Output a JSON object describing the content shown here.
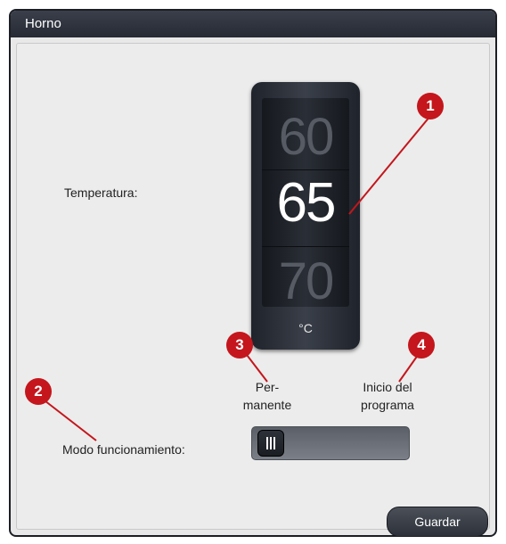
{
  "window": {
    "title": "Horno"
  },
  "temperature": {
    "label": "Temperatura:",
    "prev": "60",
    "current": "65",
    "next": "70",
    "unit": "°C"
  },
  "mode": {
    "label": "Modo funcionamiento:",
    "option_left_line1": "Per-",
    "option_left_line2": "manente",
    "option_right_line1": "Inicio del",
    "option_right_line2": "programa",
    "slider_position": 0
  },
  "buttons": {
    "save": "Guardar"
  },
  "callouts": [
    "1",
    "2",
    "3",
    "4"
  ],
  "colors": {
    "callout": "#c4161c",
    "titlebar": "#2b2f38"
  }
}
